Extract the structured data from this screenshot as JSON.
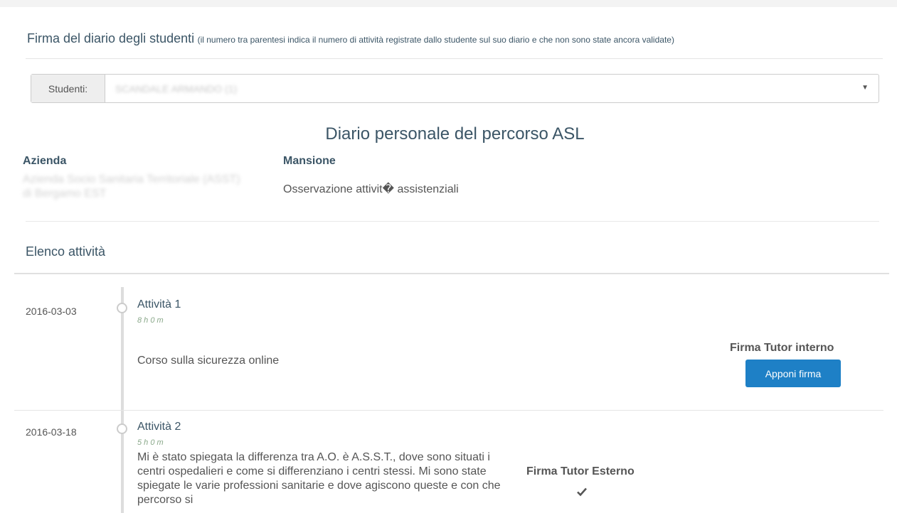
{
  "header": {
    "title": "Firma del diario degli studenti",
    "note": "(il numero tra parentesi indica il numero di attività registrate dallo studente sul suo diario e che non sono state ancora validate)"
  },
  "student_select": {
    "addon_label": "Studenti:",
    "selected_name_redacted": "SCANDALE ARMANDO (1)"
  },
  "diario": {
    "title": "Diario personale del percorso ASL",
    "azienda_label": "Azienda",
    "azienda_value_redacted": "Azienda Socio Sanitaria Territoriale (ASST) di Bergamo EST",
    "mansione_label": "Mansione",
    "mansione_value": "Osservazione attivit� assistenziali"
  },
  "activities": {
    "section_title": "Elenco attività",
    "items": [
      {
        "date": "2016-03-03",
        "title": "Attività 1",
        "duration": "8 h 0 m",
        "description": "Corso sulla sicurezza online",
        "signature_label": "Firma Tutor interno",
        "signature_button": "Apponi firma"
      },
      {
        "date": "2016-03-18",
        "title": "Attività 2",
        "duration": "5 h 0 m",
        "description": "Mi è stato spiegata la differenza tra A.O. è A.S.S.T., dove sono situati i centri ospedalieri e come si differenziano i centri stessi. Mi sono state spiegate le varie professioni sanitarie e dove agiscono queste e con che percorso si",
        "signature_label": "Firma Tutor Esterno",
        "signature_icon": "check-icon"
      }
    ]
  }
}
